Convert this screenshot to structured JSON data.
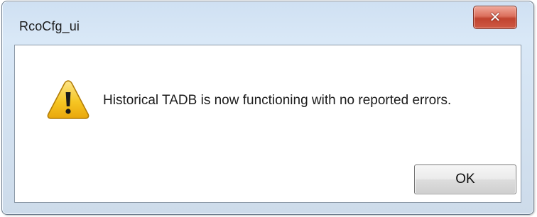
{
  "window": {
    "title": "RcoCfg_ui",
    "close_glyph": "✕",
    "close_icon": "close-icon"
  },
  "message": {
    "icon": "warning-icon",
    "text": "Historical TADB is now functioning with no reported errors."
  },
  "buttons": {
    "ok_label": "OK"
  },
  "colors": {
    "warning_fill": "#f5c518",
    "close_button": "#c8483a",
    "frame": "#cfe0f2"
  }
}
